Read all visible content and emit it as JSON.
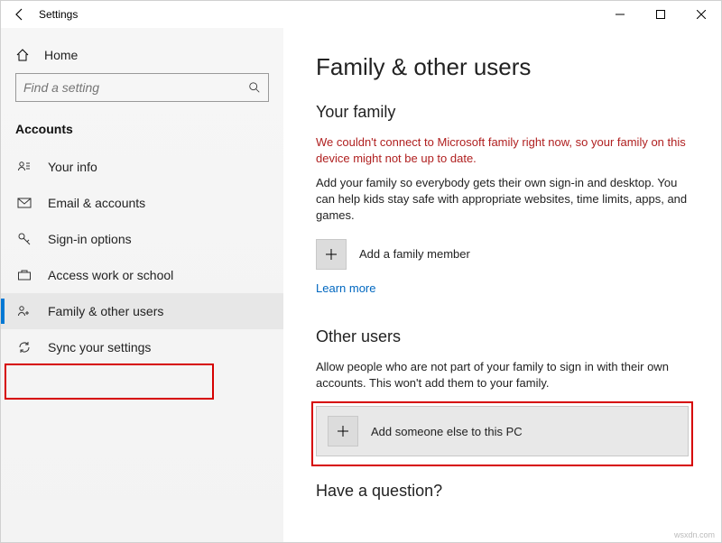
{
  "titlebar": {
    "title": "Settings"
  },
  "sidebar": {
    "home_label": "Home",
    "search_placeholder": "Find a setting",
    "section": "Accounts",
    "items": [
      {
        "label": "Your info"
      },
      {
        "label": "Email & accounts"
      },
      {
        "label": "Sign-in options"
      },
      {
        "label": "Access work or school"
      },
      {
        "label": "Family & other users"
      },
      {
        "label": "Sync your settings"
      }
    ]
  },
  "main": {
    "title": "Family & other users",
    "family_heading": "Your family",
    "family_error": "We couldn't connect to Microsoft family right now, so your family on this device might not be up to date.",
    "family_body": "Add your family so everybody gets their own sign-in and desktop. You can help kids stay safe with appropriate websites, time limits, apps, and games.",
    "add_family_label": "Add a family member",
    "learn_more": "Learn more",
    "other_heading": "Other users",
    "other_body": "Allow people who are not part of your family to sign in with their own accounts. This won't add them to your family.",
    "add_other_label": "Add someone else to this PC",
    "question_heading": "Have a question?"
  },
  "watermark": "wsxdn.com"
}
